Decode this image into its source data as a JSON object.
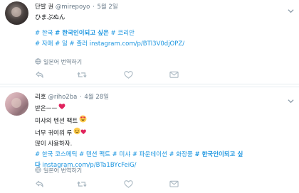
{
  "tweets": [
    {
      "name": "단발 권",
      "handle": "@mirepoyo",
      "time": "5월 2일",
      "lines": [
        {
          "type": "text",
          "text": "ひまぷぬん"
        },
        {
          "type": "gap"
        },
        {
          "type": "tags",
          "items": [
            {
              "text": "# 한국",
              "bold": false
            },
            {
              "text": "# 한국인이되고 싶은",
              "bold": true
            },
            {
              "text": "# 코리안",
              "bold": false
            }
          ]
        },
        {
          "type": "mixed",
          "items": [
            {
              "text": "# 자매",
              "kind": "tag"
            },
            {
              "text": "# 일",
              "kind": "tag"
            },
            {
              "text": "# 졸러",
              "kind": "tag"
            },
            {
              "text": "instagram.com/p/BTl3V0djOPZ/",
              "kind": "link"
            }
          ]
        }
      ],
      "translate_label": "일본어 번역하기"
    },
    {
      "name": "리호",
      "handle": "@riho2ba",
      "time": "4월 28일",
      "lines": [
        {
          "type": "text",
          "text": "받은ㅡㅡ",
          "emoji": "heart"
        },
        {
          "type": "text",
          "text": "미샤의 텐션 팩트",
          "emoji": "heart-eyes"
        },
        {
          "type": "text",
          "text": "너무 귀여워 루",
          "emoji": "smile-heart"
        },
        {
          "type": "text",
          "text": "많이 사용하자."
        },
        {
          "type": "mixed",
          "items": [
            {
              "text": "# 한국 코스메틱",
              "kind": "tag"
            },
            {
              "text": "# 텐션 팩트",
              "kind": "tag"
            },
            {
              "text": "# 미샤",
              "kind": "tag"
            },
            {
              "text": "# 파운데이션",
              "kind": "tag"
            },
            {
              "text": "# 화장품",
              "kind": "tag"
            },
            {
              "text": "# 한국인이되고 싶",
              "kind": "tag-bold"
            }
          ]
        },
        {
          "type": "mixed",
          "items": [
            {
              "text": "다",
              "kind": "tag-bold"
            },
            {
              "text": "instagram.com/p/BTa1BYcFeiG/",
              "kind": "link"
            }
          ]
        }
      ],
      "translate_label": "일본어 번역하기"
    }
  ],
  "icons": {
    "globe": "globe-icon",
    "reply": "reply-icon",
    "retweet": "retweet-icon",
    "like": "heart-icon",
    "dm": "envelope-icon",
    "caret": "chevron-down-icon"
  },
  "colors": {
    "link": "#1b95e0",
    "meta": "#657786",
    "divider": "#e6ecf0"
  }
}
